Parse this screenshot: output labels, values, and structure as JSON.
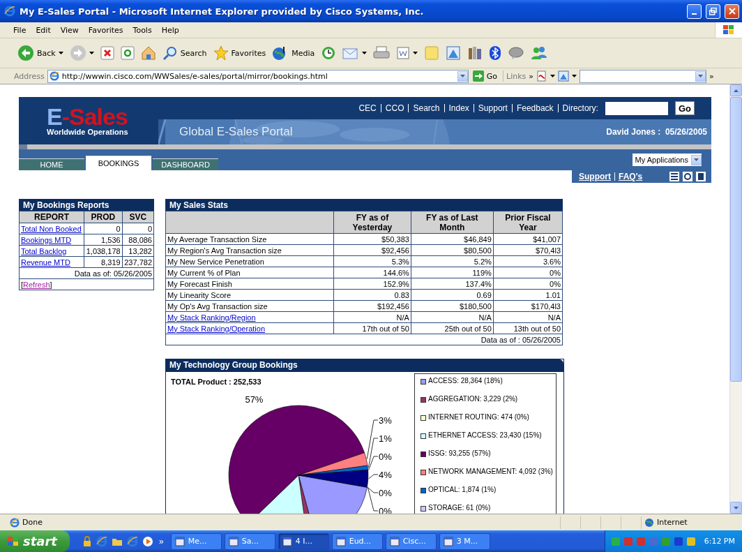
{
  "window": {
    "title": "My E-Sales Portal - Microsoft Internet Explorer provided by Cisco Systems, Inc."
  },
  "menu": [
    "File",
    "Edit",
    "View",
    "Favorites",
    "Tools",
    "Help"
  ],
  "toolbar": [
    {
      "kind": "back",
      "label": "Back",
      "dropdown": true
    },
    {
      "kind": "forward",
      "dropdown": true
    },
    {
      "kind": "stop",
      "dropdown": false
    },
    {
      "kind": "refresh",
      "dropdown": false
    },
    {
      "kind": "home",
      "dropdown": false
    },
    {
      "kind": "search",
      "label": "Search",
      "dropdown": false
    },
    {
      "kind": "favorites",
      "label": "Favorites",
      "dropdown": false
    },
    {
      "kind": "media",
      "label": "Media",
      "dropdown": false
    },
    {
      "kind": "history",
      "dropdown": false
    },
    {
      "kind": "mail",
      "dropdown": true
    },
    {
      "kind": "print",
      "dropdown": false
    },
    {
      "kind": "word",
      "dropdown": true
    },
    {
      "kind": "note",
      "dropdown": false
    },
    {
      "kind": "paint",
      "dropdown": false
    },
    {
      "kind": "books",
      "dropdown": false
    },
    {
      "kind": "bluetooth",
      "dropdown": false
    },
    {
      "kind": "chat",
      "dropdown": false
    },
    {
      "kind": "users",
      "dropdown": false
    }
  ],
  "address": {
    "label": "Address",
    "value": "http://wwwin.cisco.com/WWSales/e-sales/portal/mirror/bookings.html",
    "go": "Go",
    "links": "Links",
    "more": "»"
  },
  "header": {
    "logo": [
      "E",
      "-Sales"
    ],
    "logo_sub": "Worldwide Operations",
    "top_links": [
      "CEC",
      "CCO",
      "Search",
      "Index",
      "Support",
      "Feedback"
    ],
    "directory": "Directory:",
    "go": "Go",
    "portal_title": "Global E-Sales Portal",
    "user": "David Jones :  05/26/2005"
  },
  "tabs": [
    {
      "label": "HOME",
      "selected": false
    },
    {
      "label": "BOOKINGS",
      "selected": true
    },
    {
      "label": "DASHBOARD",
      "selected": false
    }
  ],
  "apps_select": "My Applications",
  "help_links": [
    "Support",
    "FAQ's"
  ],
  "bookings": {
    "title": "My Bookings Reports",
    "columns": [
      "REPORT",
      "PROD",
      "SVC"
    ],
    "rows": [
      {
        "report": "Total Non Booked",
        "prod": "0",
        "svc": "0"
      },
      {
        "report": "Bookings MTD",
        "prod": "1,536",
        "svc": "88,086"
      },
      {
        "report": "Total Backlog",
        "prod": "1,038,178",
        "svc": "13,282"
      },
      {
        "report": "Revenue MTD",
        "prod": "8,319",
        "svc": "237,782"
      }
    ],
    "footer": "Data as of: 05/26/2005",
    "refresh_open": "[",
    "refresh": "Refresh",
    "refresh_close": "]"
  },
  "sales_stats": {
    "title": "My Sales Stats",
    "columns": [
      "FY as of Yesterday",
      "FY as of Last Month",
      "Prior Fiscal Year"
    ],
    "rows": [
      {
        "kind": "text",
        "label": "My Average Transaction Size",
        "values": [
          "$50,383",
          "$46,849",
          "$41,007"
        ]
      },
      {
        "kind": "text",
        "label": "My Region's Avg Transaction size",
        "values": [
          "$92,456",
          "$80,500",
          "$70,4l3"
        ]
      },
      {
        "kind": "text",
        "label": "My New Service Penetration",
        "values": [
          "5.3%",
          "5.2%",
          "3.6%"
        ]
      },
      {
        "kind": "text",
        "label": "My Current % of Plan",
        "values": [
          "144.6%",
          "119%",
          "0%"
        ]
      },
      {
        "kind": "text",
        "label": "My Forecast Finish",
        "values": [
          "152.9%",
          "137.4%",
          "0%"
        ]
      },
      {
        "kind": "text",
        "label": "My Linearity Score",
        "values": [
          "0.83",
          "0.69",
          "1.01"
        ]
      },
      {
        "kind": "text",
        "label": "My Op's Avg Transaction size",
        "values": [
          "$192,456",
          "$180,500",
          "$170,4l3"
        ]
      },
      {
        "kind": "link",
        "label": "My Stack Ranking/Region",
        "values": [
          "N/A",
          "N/A",
          "N/A"
        ]
      },
      {
        "kind": "link",
        "label": "My Stack Ranking/Operation",
        "values": [
          "17th out of 50",
          "25th out of 50",
          "13th out of 50"
        ]
      }
    ],
    "footer": "Data as of : 05/26/2005"
  },
  "technology": {
    "title": "My Technology Group Bookings",
    "total": "TOTAL Product : 252,533",
    "chart_data": {
      "type": "pie",
      "values": [
        18,
        2,
        0,
        15,
        57,
        3,
        1,
        0,
        4,
        0,
        0
      ],
      "colors": [
        "#9999ff",
        "#993366",
        "#ffffcc",
        "#ccffff",
        "#660066",
        "#ff8080",
        "#0066cc",
        "#ccccff",
        "#000080",
        "#ff00ff",
        "#ffff00"
      ],
      "value_labels": [
        null,
        null,
        null,
        null,
        "57%",
        "3%",
        "1%",
        "0%",
        "4%",
        "0%",
        "0%"
      ]
    },
    "legend": [
      {
        "label": "ACCESS: 28,364 (18%)",
        "color": "#9999ff"
      },
      {
        "label": "AGGREGATION: 3,229 (2%)",
        "color": "#993366"
      },
      {
        "label": "INTERNET ROUTING: 474 (0%)",
        "color": "#ffffcc"
      },
      {
        "label": "ETHERNET ACCESS: 23,430 (15%)",
        "color": "#ccffff"
      },
      {
        "label": "ISSG: 93,255 (57%)",
        "color": "#660066"
      },
      {
        "label": "NETWORK MANAGEMENT: 4,092 (3%)",
        "color": "#ff8080"
      },
      {
        "label": "OPTICAL: 1,874 (1%)",
        "color": "#0066cc"
      },
      {
        "label": "STORAGE: 61 (0%)",
        "color": "#ccccff"
      }
    ]
  },
  "status_bar": {
    "text": "Done",
    "zone": "Internet"
  },
  "taskbar": {
    "start": "start",
    "more": "»",
    "tasks": [
      {
        "label": "Me...",
        "selected": false
      },
      {
        "label": "Sa...",
        "selected": false
      },
      {
        "label": "4 I...",
        "selected": true
      },
      {
        "label": "Eud...",
        "selected": false
      },
      {
        "label": "Cisc...",
        "selected": false
      },
      {
        "label": "3 M...",
        "selected": false
      }
    ],
    "clock": "6:12 PM"
  }
}
